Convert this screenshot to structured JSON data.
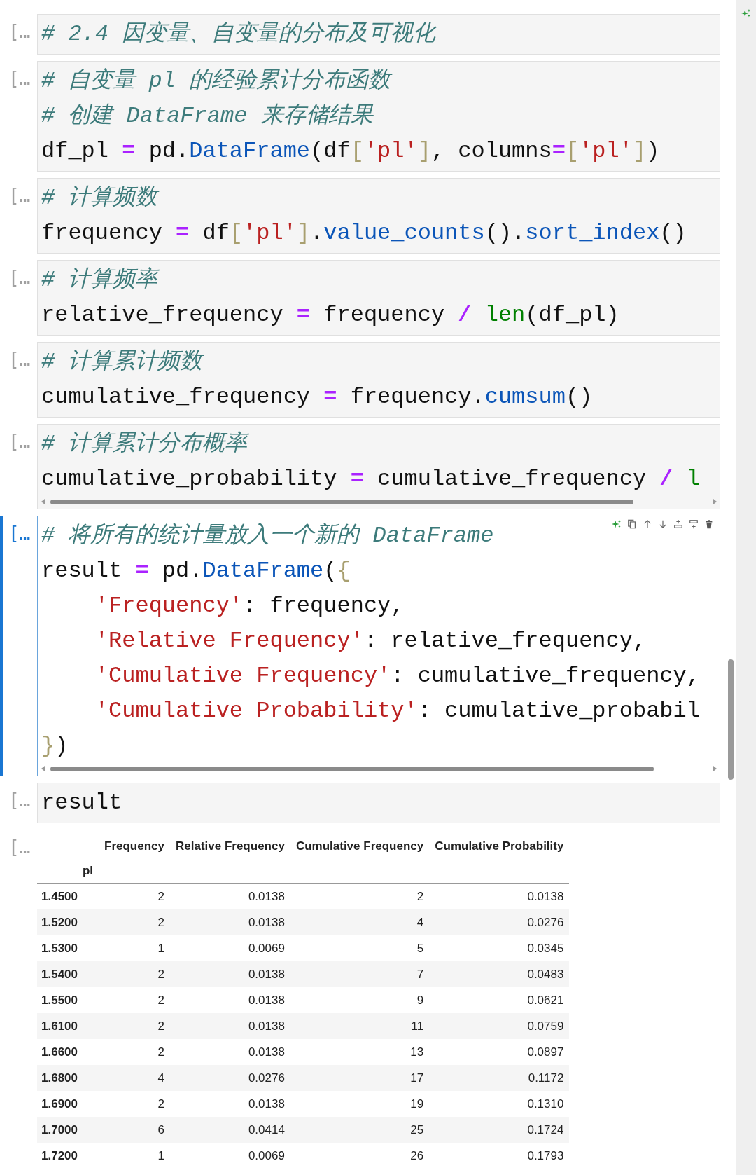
{
  "cells": [
    {
      "prompt": "[…",
      "selected": false,
      "scrollbar": false,
      "lines": [
        [
          {
            "kind": "c",
            "text": "# 2.4 因变量、自变量的分布及可视化"
          }
        ]
      ]
    },
    {
      "prompt": "[…",
      "selected": false,
      "scrollbar": false,
      "lines": [
        [
          {
            "kind": "c",
            "text": "# 自变量 pl 的经验累计分布函数"
          }
        ],
        [
          {
            "kind": "c",
            "text": "# 创建 DataFrame 来存储结果"
          }
        ],
        [
          {
            "kind": "n",
            "text": "df_pl "
          },
          {
            "kind": "o",
            "text": "="
          },
          {
            "kind": "n",
            "text": " pd."
          },
          {
            "kind": "f",
            "text": "DataFrame"
          },
          {
            "kind": "n",
            "text": "(df"
          },
          {
            "kind": "b",
            "text": "["
          },
          {
            "kind": "s",
            "text": "'pl'"
          },
          {
            "kind": "b",
            "text": "]"
          },
          {
            "kind": "n",
            "text": ", columns"
          },
          {
            "kind": "o",
            "text": "="
          },
          {
            "kind": "b",
            "text": "["
          },
          {
            "kind": "s",
            "text": "'pl'"
          },
          {
            "kind": "b",
            "text": "]"
          },
          {
            "kind": "n",
            "text": ")"
          }
        ]
      ]
    },
    {
      "prompt": "[…",
      "selected": false,
      "scrollbar": false,
      "lines": [
        [
          {
            "kind": "c",
            "text": "# 计算频数"
          }
        ],
        [
          {
            "kind": "n",
            "text": "frequency "
          },
          {
            "kind": "o",
            "text": "="
          },
          {
            "kind": "n",
            "text": " df"
          },
          {
            "kind": "b",
            "text": "["
          },
          {
            "kind": "s",
            "text": "'pl'"
          },
          {
            "kind": "b",
            "text": "]"
          },
          {
            "kind": "n",
            "text": "."
          },
          {
            "kind": "f",
            "text": "value_counts"
          },
          {
            "kind": "n",
            "text": "()."
          },
          {
            "kind": "f",
            "text": "sort_index"
          },
          {
            "kind": "n",
            "text": "()"
          }
        ]
      ]
    },
    {
      "prompt": "[…",
      "selected": false,
      "scrollbar": false,
      "lines": [
        [
          {
            "kind": "c",
            "text": "# 计算频率"
          }
        ],
        [
          {
            "kind": "n",
            "text": "relative_frequency "
          },
          {
            "kind": "o",
            "text": "="
          },
          {
            "kind": "n",
            "text": " frequency "
          },
          {
            "kind": "o",
            "text": "/"
          },
          {
            "kind": "g",
            "text": " len"
          },
          {
            "kind": "n",
            "text": "(df_pl)"
          }
        ]
      ]
    },
    {
      "prompt": "[…",
      "selected": false,
      "scrollbar": false,
      "lines": [
        [
          {
            "kind": "c",
            "text": "# 计算累计频数"
          }
        ],
        [
          {
            "kind": "n",
            "text": "cumulative_frequency "
          },
          {
            "kind": "o",
            "text": "="
          },
          {
            "kind": "n",
            "text": " frequency."
          },
          {
            "kind": "f",
            "text": "cumsum"
          },
          {
            "kind": "n",
            "text": "()"
          }
        ]
      ]
    },
    {
      "prompt": "[…",
      "selected": false,
      "scrollbar": true,
      "lines": [
        [
          {
            "kind": "c",
            "text": "# 计算累计分布概率"
          }
        ],
        [
          {
            "kind": "n",
            "text": "cumulative_probability "
          },
          {
            "kind": "o",
            "text": "="
          },
          {
            "kind": "n",
            "text": " cumulative_frequency "
          },
          {
            "kind": "o",
            "text": "/"
          },
          {
            "kind": "g",
            "text": " l"
          }
        ]
      ]
    },
    {
      "prompt": "[…",
      "selected": true,
      "scrollbar": true,
      "lines": [
        [
          {
            "kind": "c",
            "text": "# 将所有的统计量放入一个新的 DataFrame"
          }
        ],
        [
          {
            "kind": "n",
            "text": "result "
          },
          {
            "kind": "o",
            "text": "="
          },
          {
            "kind": "n",
            "text": " pd."
          },
          {
            "kind": "f",
            "text": "DataFrame"
          },
          {
            "kind": "n",
            "text": "("
          },
          {
            "kind": "b",
            "text": "{"
          }
        ],
        [
          {
            "kind": "s",
            "text": "    'Frequency'"
          },
          {
            "kind": "n",
            "text": ": frequency,"
          }
        ],
        [
          {
            "kind": "s",
            "text": "    'Relative Frequency'"
          },
          {
            "kind": "n",
            "text": ": relative_frequency,"
          }
        ],
        [
          {
            "kind": "s",
            "text": "    'Cumulative Frequency'"
          },
          {
            "kind": "n",
            "text": ": cumulative_frequency,"
          }
        ],
        [
          {
            "kind": "s",
            "text": "    'Cumulative Probability'"
          },
          {
            "kind": "n",
            "text": ": cumulative_probabil"
          }
        ],
        [
          {
            "kind": "b",
            "text": "}"
          },
          {
            "kind": "n",
            "text": ")"
          }
        ]
      ]
    },
    {
      "prompt": "[…",
      "selected": false,
      "scrollbar": false,
      "lines": [
        [
          {
            "kind": "n",
            "text": "result"
          }
        ]
      ]
    }
  ],
  "output": {
    "prompt": "[…",
    "table": {
      "index_name": "pl",
      "columns": [
        "Frequency",
        "Relative Frequency",
        "Cumulative Frequency",
        "Cumulative Probability"
      ],
      "rows": [
        {
          "index": "1.4500",
          "cells": [
            "2",
            "0.0138",
            "2",
            "0.0138"
          ]
        },
        {
          "index": "1.5200",
          "cells": [
            "2",
            "0.0138",
            "4",
            "0.0276"
          ]
        },
        {
          "index": "1.5300",
          "cells": [
            "1",
            "0.0069",
            "5",
            "0.0345"
          ]
        },
        {
          "index": "1.5400",
          "cells": [
            "2",
            "0.0138",
            "7",
            "0.0483"
          ]
        },
        {
          "index": "1.5500",
          "cells": [
            "2",
            "0.0138",
            "9",
            "0.0621"
          ]
        },
        {
          "index": "1.6100",
          "cells": [
            "2",
            "0.0138",
            "11",
            "0.0759"
          ]
        },
        {
          "index": "1.6600",
          "cells": [
            "2",
            "0.0138",
            "13",
            "0.0897"
          ]
        },
        {
          "index": "1.6800",
          "cells": [
            "4",
            "0.0276",
            "17",
            "0.1172"
          ]
        },
        {
          "index": "1.6900",
          "cells": [
            "2",
            "0.0138",
            "19",
            "0.1310"
          ]
        },
        {
          "index": "1.7000",
          "cells": [
            "6",
            "0.0414",
            "25",
            "0.1724"
          ]
        },
        {
          "index": "1.7200",
          "cells": [
            "1",
            "0.0069",
            "26",
            "0.1793"
          ]
        }
      ]
    }
  }
}
